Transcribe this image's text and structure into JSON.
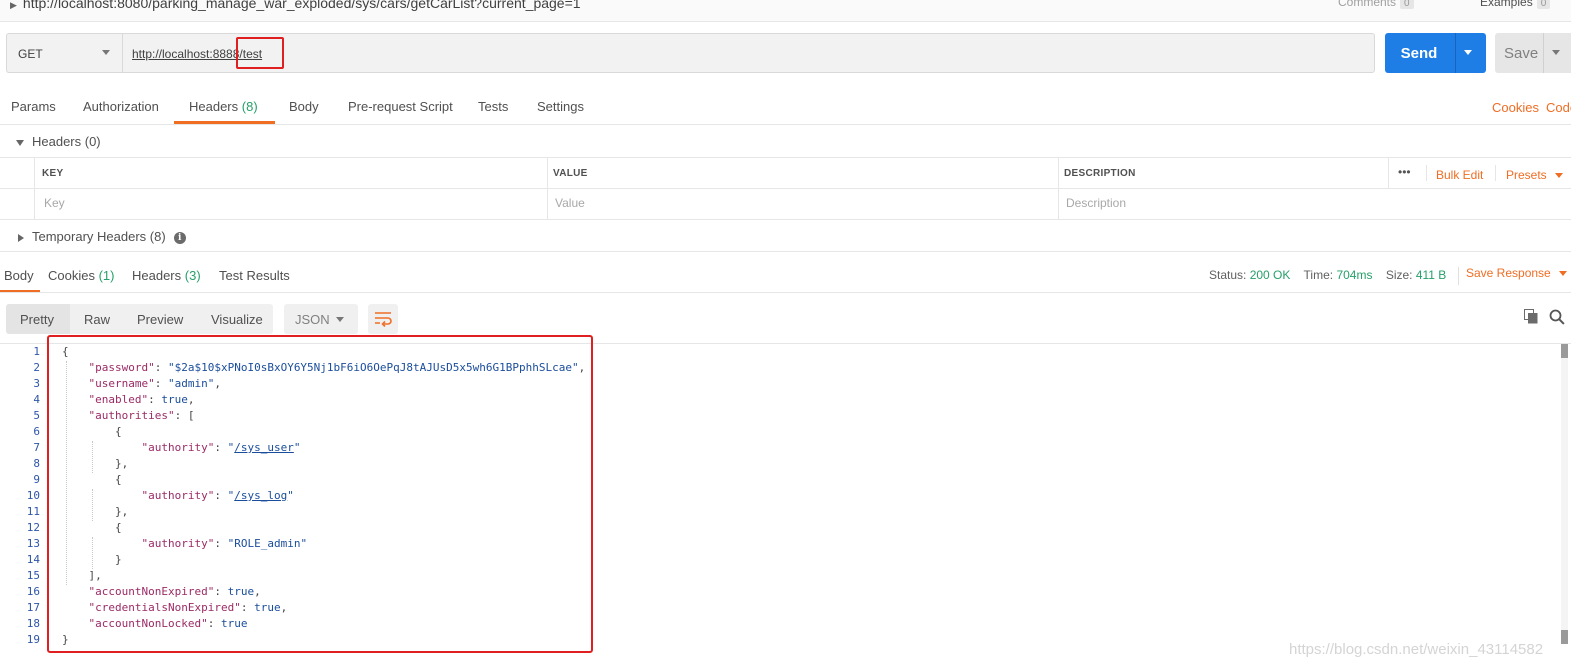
{
  "top_bar": {
    "url": "http://localhost:8080/parking_manage_war_exploded/sys/cars/getCarList?current_page=1",
    "comments_label": "Comments",
    "comments_count": "0",
    "examples_label": "Examples",
    "examples_count": "0"
  },
  "request": {
    "method": "GET",
    "url": "http://localhost:8888/test",
    "send_label": "Send",
    "save_label": "Save"
  },
  "request_tabs": [
    {
      "label": "Params",
      "count": ""
    },
    {
      "label": "Authorization",
      "count": ""
    },
    {
      "label": "Headers",
      "count": "(8)"
    },
    {
      "label": "Body",
      "count": ""
    },
    {
      "label": "Pre-request Script",
      "count": ""
    },
    {
      "label": "Tests",
      "count": ""
    },
    {
      "label": "Settings",
      "count": ""
    }
  ],
  "right_links": {
    "cookies": "Cookies",
    "code": "Code"
  },
  "headers_section": {
    "title": "Headers (0)",
    "columns": {
      "key": "KEY",
      "value": "VALUE",
      "description": "DESCRIPTION"
    },
    "placeholders": {
      "key": "Key",
      "value": "Value",
      "description": "Description"
    },
    "more": "•••",
    "bulk_edit": "Bulk Edit",
    "presets": "Presets",
    "temporary_headers": "Temporary Headers (8)",
    "info_glyph": "i"
  },
  "response_tabs": [
    {
      "label": "Body",
      "count": ""
    },
    {
      "label": "Cookies",
      "count": "(1)"
    },
    {
      "label": "Headers",
      "count": "(3)"
    },
    {
      "label": "Test Results",
      "count": ""
    }
  ],
  "response_status": {
    "status_label": "Status:",
    "status_value": "200 OK",
    "time_label": "Time:",
    "time_value": "704ms",
    "size_label": "Size:",
    "size_value": "411 B",
    "save_response": "Save Response"
  },
  "view_modes": [
    "Pretty",
    "Raw",
    "Preview",
    "Visualize"
  ],
  "format": "JSON",
  "code_lines": [
    [
      {
        "t": "p",
        "v": "{"
      }
    ],
    [
      {
        "t": "k",
        "v": "\"password\""
      },
      {
        "t": "p",
        "v": ": "
      },
      {
        "t": "s",
        "v": "\"$2a$10$xPNoI0sBxOY6Y5Nj1bF6iO6OePqJ8tAJUsD5x5wh6G1BPphhSLcae\""
      },
      {
        "t": "p",
        "v": ","
      }
    ],
    [
      {
        "t": "k",
        "v": "\"username\""
      },
      {
        "t": "p",
        "v": ": "
      },
      {
        "t": "s",
        "v": "\"admin\""
      },
      {
        "t": "p",
        "v": ","
      }
    ],
    [
      {
        "t": "k",
        "v": "\"enabled\""
      },
      {
        "t": "p",
        "v": ": "
      },
      {
        "t": "b",
        "v": "true"
      },
      {
        "t": "p",
        "v": ","
      }
    ],
    [
      {
        "t": "k",
        "v": "\"authorities\""
      },
      {
        "t": "p",
        "v": ": ["
      }
    ],
    [
      {
        "t": "p",
        "v": "{"
      }
    ],
    [
      {
        "t": "k",
        "v": "\"authority\""
      },
      {
        "t": "p",
        "v": ": "
      },
      {
        "t": "s",
        "v": "\""
      },
      {
        "t": "u",
        "v": "/sys_user"
      },
      {
        "t": "s",
        "v": "\""
      }
    ],
    [
      {
        "t": "p",
        "v": "},"
      }
    ],
    [
      {
        "t": "p",
        "v": "{"
      }
    ],
    [
      {
        "t": "k",
        "v": "\"authority\""
      },
      {
        "t": "p",
        "v": ": "
      },
      {
        "t": "s",
        "v": "\""
      },
      {
        "t": "u",
        "v": "/sys_log"
      },
      {
        "t": "s",
        "v": "\""
      }
    ],
    [
      {
        "t": "p",
        "v": "},"
      }
    ],
    [
      {
        "t": "p",
        "v": "{"
      }
    ],
    [
      {
        "t": "k",
        "v": "\"authority\""
      },
      {
        "t": "p",
        "v": ": "
      },
      {
        "t": "s",
        "v": "\"ROLE_admin\""
      }
    ],
    [
      {
        "t": "p",
        "v": "}"
      }
    ],
    [
      {
        "t": "p",
        "v": "],"
      }
    ],
    [
      {
        "t": "k",
        "v": "\"accountNonExpired\""
      },
      {
        "t": "p",
        "v": ": "
      },
      {
        "t": "b",
        "v": "true"
      },
      {
        "t": "p",
        "v": ","
      }
    ],
    [
      {
        "t": "k",
        "v": "\"credentialsNonExpired\""
      },
      {
        "t": "p",
        "v": ": "
      },
      {
        "t": "b",
        "v": "true"
      },
      {
        "t": "p",
        "v": ","
      }
    ],
    [
      {
        "t": "k",
        "v": "\"accountNonLocked\""
      },
      {
        "t": "p",
        "v": ": "
      },
      {
        "t": "b",
        "v": "true"
      }
    ],
    [
      {
        "t": "p",
        "v": "}"
      }
    ]
  ],
  "watermark": "https://blog.csdn.net/weixin_43114582",
  "colors": {
    "accent": "#f06d24",
    "send": "#1f7ee6",
    "success": "#26a06a",
    "highlight": "#e02020"
  }
}
